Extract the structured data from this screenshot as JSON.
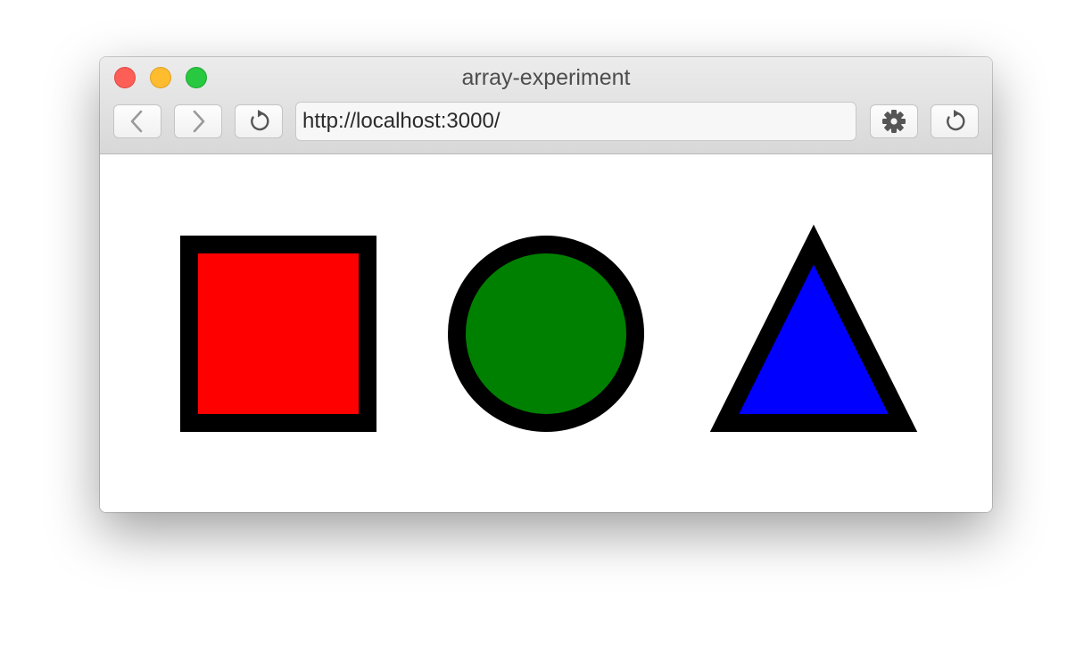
{
  "window": {
    "title": "array-experiment",
    "url": "http://localhost:3000/"
  },
  "toolbar": {
    "icons": [
      "back-chevron-icon",
      "forward-chevron-icon",
      "reload-icon",
      "gear-icon",
      "reload-icon"
    ]
  },
  "shapes": [
    {
      "kind": "square",
      "fill": "#ff0000",
      "stroke": "#000000"
    },
    {
      "kind": "circle",
      "fill": "#008000",
      "stroke": "#000000"
    },
    {
      "kind": "triangle",
      "fill": "#0000ff",
      "stroke": "#000000"
    }
  ]
}
